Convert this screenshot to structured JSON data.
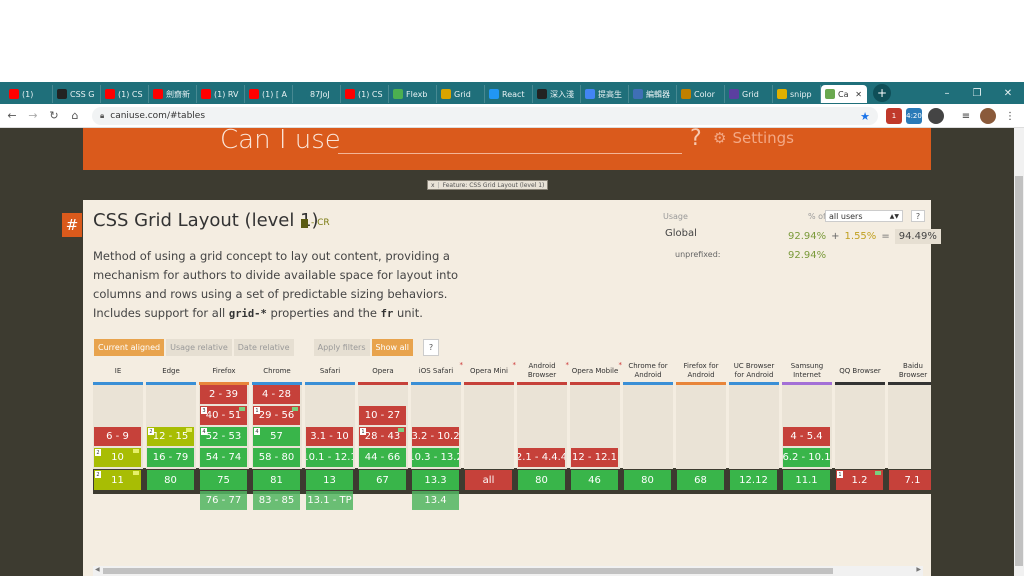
{
  "browser": {
    "tabs": [
      {
        "label": "(1)",
        "icon": "youtube-icon",
        "color": "#ff0000"
      },
      {
        "label": "CSS G",
        "icon": "github-icon",
        "color": "#222222"
      },
      {
        "label": "(1) CS",
        "icon": "youtube-icon",
        "color": "#ff0000"
      },
      {
        "label": "劍齋新",
        "icon": "youtube-icon",
        "color": "#ff0000"
      },
      {
        "label": "(1) RV",
        "icon": "youtube-icon",
        "color": "#ff0000"
      },
      {
        "label": "(1) [ A",
        "icon": "youtube-icon",
        "color": "#ff0000"
      },
      {
        "label": "87JoJ",
        "icon": "page-icon",
        "color": "#1f6f7a"
      },
      {
        "label": "(1) CS",
        "icon": "youtube-icon",
        "color": "#ff0000"
      },
      {
        "label": "Flexb",
        "icon": "frog-icon",
        "color": "#4caf50"
      },
      {
        "label": "Grid",
        "icon": "medal-icon",
        "color": "#d9a400"
      },
      {
        "label": "React",
        "icon": "f-icon",
        "color": "#2196f3"
      },
      {
        "label": "深入淺",
        "icon": "github-icon",
        "color": "#222222"
      },
      {
        "label": "提高生",
        "icon": "google-icon",
        "color": "#4285f4"
      },
      {
        "label": "編輯器",
        "icon": "app-icon",
        "color": "#3f6fb5"
      },
      {
        "label": "Color",
        "icon": "cup-icon",
        "color": "#c08000"
      },
      {
        "label": "Grid",
        "icon": "b-icon",
        "color": "#5b3fa0"
      },
      {
        "label": "snipp",
        "icon": "snippet-icon",
        "color": "#e0b000"
      }
    ],
    "active_tab": {
      "label": "Ca",
      "icon": "caniuse-icon",
      "color": "#6aa84f"
    },
    "new_tab": "+",
    "window_controls": {
      "minimize": "–",
      "restore": "❐",
      "close": "✕"
    },
    "url": "caniuse.com/#tables",
    "extensions": {
      "abp_badge": "1",
      "time_badge": "4:20"
    }
  },
  "header": {
    "title": "Can I use",
    "question_mark": "?",
    "settings_label": "Settings"
  },
  "feature_chip": {
    "close": "x",
    "label": "Feature: CSS Grid Layout (level 1)"
  },
  "feature": {
    "hash": "#",
    "title": "CSS Grid Layout (level 1)",
    "status": "- CR",
    "description_parts": {
      "p1": "Method of using a grid concept to lay out content, providing a mechanism for authors to divide available space for layout into columns and rows using a set of predictable sizing behaviors. Includes support for all ",
      "code1": "grid-*",
      "p2": " properties and the ",
      "code2": "fr",
      "p3": " unit."
    }
  },
  "usage": {
    "label": "Usage",
    "pct_of": "% of",
    "selector": "all users",
    "help": "?",
    "global_label": "Global",
    "supported": "92.94%",
    "plus": "+",
    "partial": "1.55%",
    "equals": "=",
    "total": "94.49%",
    "unprefixed_label": "unprefixed:",
    "unprefixed_value": "92.94%"
  },
  "filters": {
    "current_aligned": "Current aligned",
    "usage_relative": "Usage relative",
    "date_relative": "Date relative",
    "apply_filters": "Apply filters",
    "show_all": "Show all",
    "help": "?"
  },
  "colors": {
    "supported": "#39b54a",
    "unsupported": "#c6413a",
    "partial": "#a8bd04",
    "brand": "#da5a1c"
  },
  "browsers": [
    {
      "name": "IE",
      "bar": "#3a8fd6",
      "ast": false,
      "cells": [
        {
          "row": 2,
          "v": "6 - 9",
          "s": "n"
        },
        {
          "row": 3,
          "v": "10",
          "s": "a",
          "note": "2",
          "flag": true
        },
        {
          "row": 4,
          "v": "11",
          "s": "a",
          "note": "2",
          "flag": true
        }
      ]
    },
    {
      "name": "Edge",
      "bar": "#3a8fd6",
      "ast": false,
      "cells": [
        {
          "row": 2,
          "v": "12 - 15",
          "s": "a",
          "note": "2",
          "flag": true
        },
        {
          "row": 3,
          "v": "16 - 79",
          "s": "y"
        },
        {
          "row": 4,
          "v": "80",
          "s": "y"
        }
      ]
    },
    {
      "name": "Firefox",
      "bar": "#e8853a",
      "ast": false,
      "cells": [
        {
          "row": 0,
          "v": "2 - 39",
          "s": "n"
        },
        {
          "row": 1,
          "v": "40 - 51",
          "s": "n",
          "note": "3",
          "flag": true
        },
        {
          "row": 2,
          "v": "52 - 53",
          "s": "y",
          "note": "4"
        },
        {
          "row": 3,
          "v": "54 - 74",
          "s": "y"
        },
        {
          "row": 4,
          "v": "75",
          "s": "y"
        },
        {
          "row": 5,
          "v": "76 - 77",
          "s": "f"
        }
      ]
    },
    {
      "name": "Chrome",
      "bar": "#3a8fd6",
      "ast": false,
      "cells": [
        {
          "row": 0,
          "v": "4 - 28",
          "s": "n"
        },
        {
          "row": 1,
          "v": "29 - 56",
          "s": "n",
          "note": "1",
          "flag": true
        },
        {
          "row": 2,
          "v": "57",
          "s": "y",
          "note": "4"
        },
        {
          "row": 3,
          "v": "58 - 80",
          "s": "y"
        },
        {
          "row": 4,
          "v": "81",
          "s": "y"
        },
        {
          "row": 5,
          "v": "83 - 85",
          "s": "f"
        }
      ]
    },
    {
      "name": "Safari",
      "bar": "#3a8fd6",
      "ast": false,
      "cells": [
        {
          "row": 2,
          "v": "3.1 - 10",
          "s": "n"
        },
        {
          "row": 3,
          "v": "10.1 - 12.1",
          "s": "y"
        },
        {
          "row": 4,
          "v": "13",
          "s": "y"
        },
        {
          "row": 5,
          "v": "13.1 - TP",
          "s": "f"
        }
      ]
    },
    {
      "name": "Opera",
      "bar": "#c6413a",
      "ast": false,
      "cells": [
        {
          "row": 1,
          "v": "10 - 27",
          "s": "n"
        },
        {
          "row": 2,
          "v": "28 - 43",
          "s": "n",
          "note": "1",
          "flag": true
        },
        {
          "row": 3,
          "v": "44 - 66",
          "s": "y"
        },
        {
          "row": 4,
          "v": "67",
          "s": "y"
        }
      ]
    },
    {
      "name": "iOS Safari",
      "bar": "#3a8fd6",
      "ast": true,
      "cells": [
        {
          "row": 2,
          "v": "3.2 - 10.2",
          "s": "n"
        },
        {
          "row": 3,
          "v": "10.3 - 13.2",
          "s": "y"
        },
        {
          "row": 4,
          "v": "13.3",
          "s": "y"
        },
        {
          "row": 5,
          "v": "13.4",
          "s": "f"
        }
      ]
    },
    {
      "name": "Opera Mini",
      "bar": "#c6413a",
      "ast": true,
      "cells": [
        {
          "row": 4,
          "v": "all",
          "s": "n"
        }
      ]
    },
    {
      "name": "Android Browser",
      "bar": "#c6413a",
      "ast": true,
      "cells": [
        {
          "row": 3,
          "v": "2.1 - 4.4.4",
          "s": "n"
        },
        {
          "row": 4,
          "v": "80",
          "s": "y"
        }
      ]
    },
    {
      "name": "Opera Mobile",
      "bar": "#c6413a",
      "ast": true,
      "cells": [
        {
          "row": 3,
          "v": "12 - 12.1",
          "s": "n"
        },
        {
          "row": 4,
          "v": "46",
          "s": "y"
        }
      ]
    },
    {
      "name": "Chrome for Android",
      "bar": "#3a8fd6",
      "ast": false,
      "cells": [
        {
          "row": 4,
          "v": "80",
          "s": "y"
        }
      ]
    },
    {
      "name": "Firefox for Android",
      "bar": "#e8853a",
      "ast": false,
      "cells": [
        {
          "row": 4,
          "v": "68",
          "s": "y"
        }
      ]
    },
    {
      "name": "UC Browser for Android",
      "bar": "#3a8fd6",
      "ast": false,
      "cells": [
        {
          "row": 4,
          "v": "12.12",
          "s": "y"
        }
      ]
    },
    {
      "name": "Samsung Internet",
      "bar": "#a36fd6",
      "ast": false,
      "cells": [
        {
          "row": 2,
          "v": "4 - 5.4",
          "s": "n"
        },
        {
          "row": 3,
          "v": "6.2 - 10.1",
          "s": "y"
        },
        {
          "row": 4,
          "v": "11.1",
          "s": "y"
        }
      ]
    },
    {
      "name": "QQ Browser",
      "bar": "#333333",
      "ast": false,
      "cells": [
        {
          "row": 4,
          "v": "1.2",
          "s": "n",
          "note": "1",
          "flag": true
        }
      ]
    },
    {
      "name": "Baidu Browser",
      "bar": "#333333",
      "ast": false,
      "cells": [
        {
          "row": 4,
          "v": "7.1",
          "s": "n"
        }
      ]
    }
  ]
}
